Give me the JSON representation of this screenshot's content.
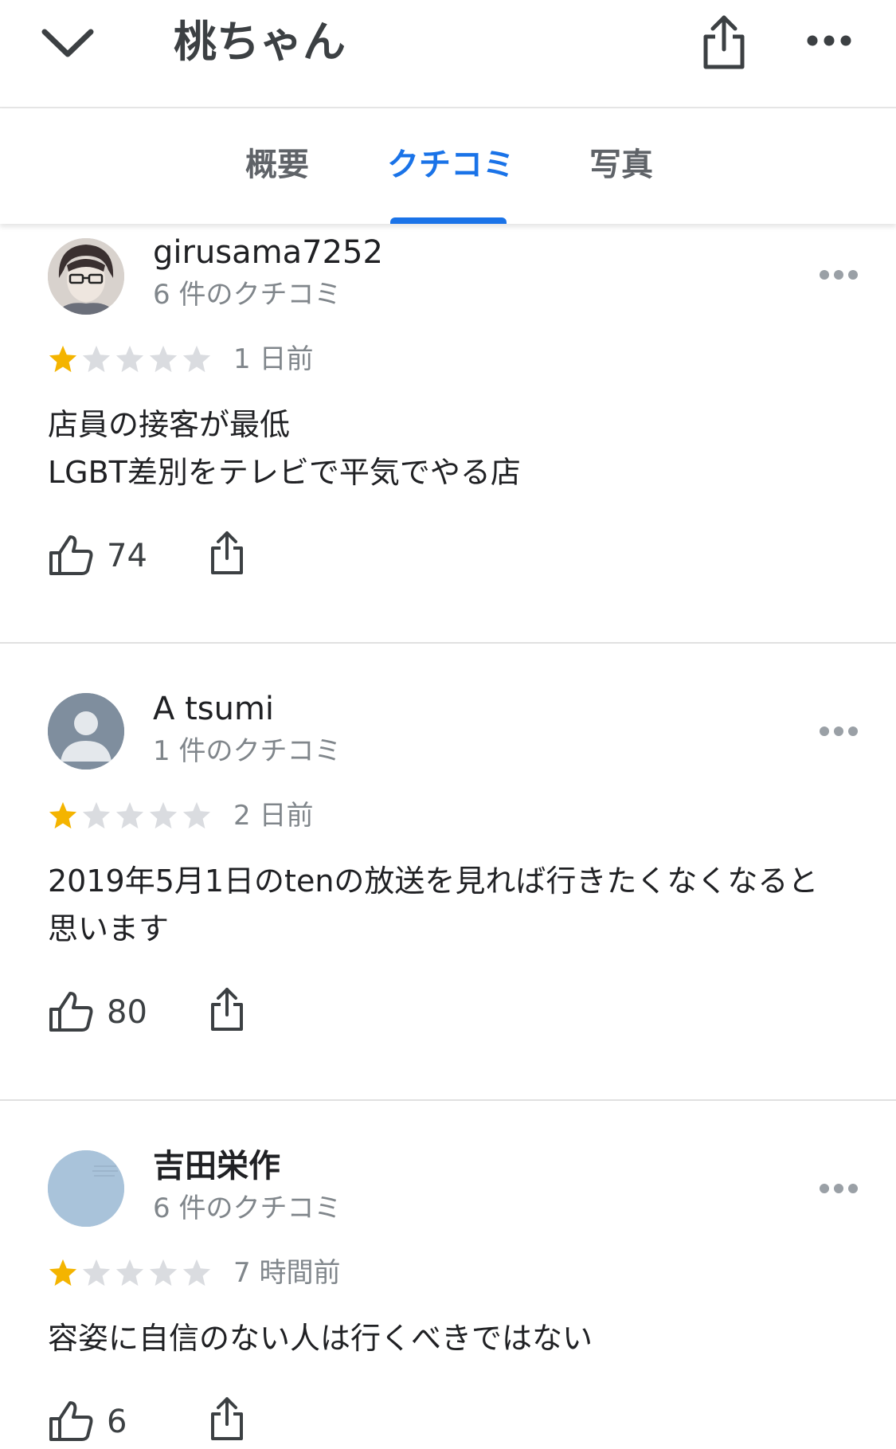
{
  "header": {
    "title": "桃ちゃん",
    "back_icon": "chevron-down-icon",
    "share_icon": "share-icon",
    "more_icon": "more-horizontal-icon"
  },
  "tabs": [
    {
      "label": "概要",
      "active": false
    },
    {
      "label": "クチコミ",
      "active": true
    },
    {
      "label": "写真",
      "active": false
    }
  ],
  "colors": {
    "accent": "#1a73e8",
    "star_filled": "#f4b400",
    "star_empty": "#dadce0",
    "secondary_text": "#80868b"
  },
  "reviews": [
    {
      "author": "girusama7252",
      "review_count": "6 件のクチコミ",
      "rating": 1,
      "rating_max": 5,
      "time": "1 日前",
      "text": "店員の接客が最低\nLGBT差別をテレビで平気でやる店",
      "likes": "74"
    },
    {
      "author": "A tsumi",
      "review_count": "1 件のクチコミ",
      "rating": 1,
      "rating_max": 5,
      "time": "2 日前",
      "text": "2019年5月1日のtenの放送を見れば行きたくなくなると\n思います",
      "likes": "80"
    },
    {
      "author": "吉田栄作",
      "review_count": "6 件のクチコミ",
      "rating": 1,
      "rating_max": 5,
      "time": "7 時間前",
      "text": "容姿に自信のない人は行くべきではない",
      "likes": "6"
    }
  ]
}
